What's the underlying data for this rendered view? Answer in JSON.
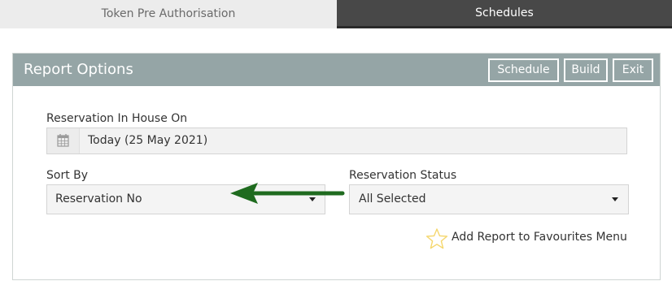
{
  "tabs": [
    {
      "label": "Token Pre Authorisation"
    },
    {
      "label": "Schedules"
    }
  ],
  "panel": {
    "title": "Report Options",
    "buttons": {
      "schedule": "Schedule",
      "build": "Build",
      "exit": "Exit"
    }
  },
  "form": {
    "in_house_label": "Reservation In House On",
    "in_house_value": "Today (25 May 2021)",
    "sort_by_label": "Sort By",
    "sort_by_value": "Reservation No",
    "status_label": "Reservation Status",
    "status_value": "All Selected",
    "favourites_label": "Add Report to Favourites Menu"
  },
  "icons": {
    "date_addon": "calendar-icon",
    "favourites": "star-icon",
    "annotation": "arrow-left-icon"
  },
  "colors": {
    "header_bg": "#95a5a6",
    "active_tab_bg": "#484848",
    "arrow": "#1f6b1f",
    "star": "#f5d76e"
  }
}
